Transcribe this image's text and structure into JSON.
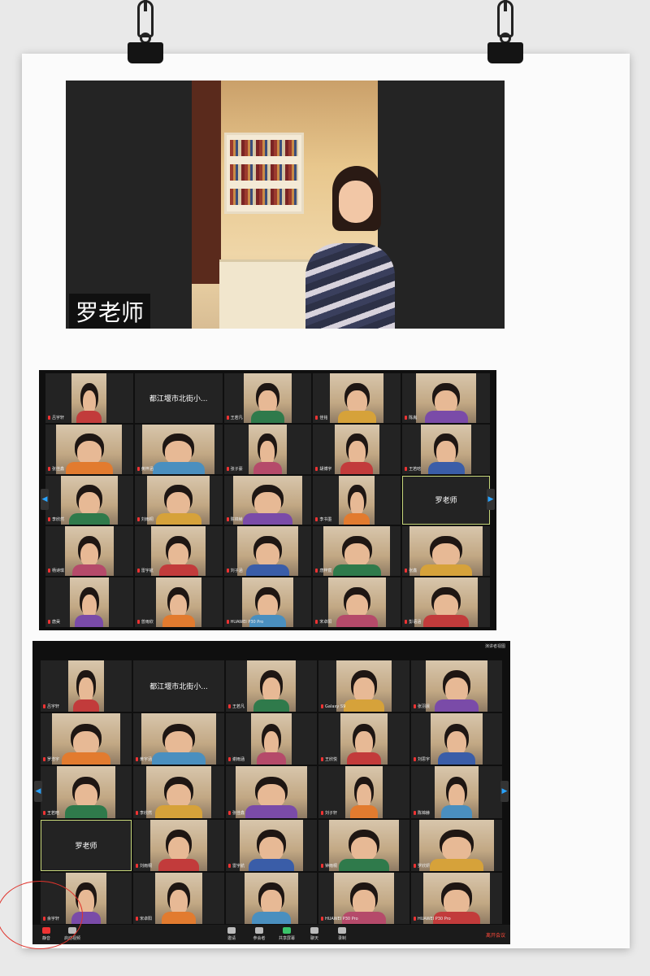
{
  "teacher": {
    "name": "罗老师"
  },
  "grid1": {
    "tiles": [
      {
        "label": "吕宇轩",
        "name": "",
        "video": true
      },
      {
        "label": "",
        "name": "都江堰市北街小...",
        "video": false
      },
      {
        "label": "王若凡",
        "name": "",
        "video": true
      },
      {
        "label": "佳铭",
        "name": "",
        "video": true
      },
      {
        "label": "陈胤",
        "name": "",
        "video": true
      },
      {
        "label": "张佳鑫",
        "name": "",
        "video": true
      },
      {
        "label": "黄梓涵",
        "name": "",
        "video": true
      },
      {
        "label": "张子豪",
        "name": "",
        "video": true
      },
      {
        "label": "胡博宇",
        "name": "",
        "video": true
      },
      {
        "label": "王若晗",
        "name": "",
        "video": true
      },
      {
        "label": "李欣然",
        "name": "",
        "video": true
      },
      {
        "label": "刘雨桐",
        "name": "",
        "video": true
      },
      {
        "label": "陈锦赫",
        "name": "",
        "video": true
      },
      {
        "label": "李书墨",
        "name": "",
        "video": true
      },
      {
        "label": "",
        "name": "罗老师",
        "video": false
      },
      {
        "label": "杨诗琪",
        "name": "",
        "video": true
      },
      {
        "label": "雷宇航",
        "name": "",
        "video": true
      },
      {
        "label": "刘子涵",
        "name": "",
        "video": true
      },
      {
        "label": "唐梓宸",
        "name": "",
        "video": true
      },
      {
        "label": "张鑫",
        "name": "",
        "video": true
      },
      {
        "label": "唐昊",
        "name": "",
        "video": true
      },
      {
        "label": "曾雨欣",
        "name": "",
        "video": true
      },
      {
        "label": "HUAWEI P30 Pro",
        "name": "",
        "video": true
      },
      {
        "label": "宋卓阳",
        "name": "",
        "video": true
      },
      {
        "label": "彭语涵",
        "name": "",
        "video": true
      }
    ]
  },
  "grid2": {
    "top_label": "演讲者视图",
    "tiles": [
      {
        "label": "吕宇轩",
        "name": "",
        "video": true
      },
      {
        "label": "",
        "name": "都江堰市北街小...",
        "video": false
      },
      {
        "label": "王若凡",
        "name": "",
        "video": true
      },
      {
        "label": "Galaxy S9",
        "name": "",
        "video": true
      },
      {
        "label": "张羽晨",
        "name": "",
        "video": true
      },
      {
        "label": "罗浩宇",
        "name": "",
        "video": true
      },
      {
        "label": "黄宇涵",
        "name": "",
        "video": true
      },
      {
        "label": "谢雨涵",
        "name": "",
        "video": true
      },
      {
        "label": "王欣悦",
        "name": "",
        "video": true
      },
      {
        "label": "刘思宇",
        "name": "",
        "video": true
      },
      {
        "label": "王若晗",
        "name": "",
        "video": true
      },
      {
        "label": "李欣然",
        "name": "",
        "video": true
      },
      {
        "label": "张佳鑫",
        "name": "",
        "video": true
      },
      {
        "label": "刘子轩",
        "name": "",
        "video": true
      },
      {
        "label": "陈锦赫",
        "name": "",
        "video": true
      },
      {
        "label": "",
        "name": "罗老师",
        "video": false
      },
      {
        "label": "刘雨桐",
        "name": "",
        "video": true
      },
      {
        "label": "雷宇航",
        "name": "",
        "video": true
      },
      {
        "label": "钟雨桐",
        "name": "",
        "video": true
      },
      {
        "label": "罗欣妍",
        "name": "",
        "video": true
      },
      {
        "label": "余宇轩",
        "name": "",
        "video": true
      },
      {
        "label": "宋卓阳",
        "name": "",
        "video": true
      },
      {
        "label": "",
        "name": "",
        "video": true
      },
      {
        "label": "HUAWEI P30 Pro",
        "name": "",
        "video": true
      },
      {
        "label": "HUAWEI P30 Pro",
        "name": "",
        "video": true
      }
    ],
    "toolbar": {
      "mute": "静音",
      "video": "启动视频",
      "invite": "邀请",
      "participants": "参会者",
      "share": "共享屏幕",
      "chat": "聊天",
      "record": "录制",
      "end": "离开会议"
    }
  },
  "colors": {
    "accent": "#29a3ff",
    "end": "#ff4a3a",
    "active_border": "#c6d67a",
    "circle": "#e0342c"
  }
}
